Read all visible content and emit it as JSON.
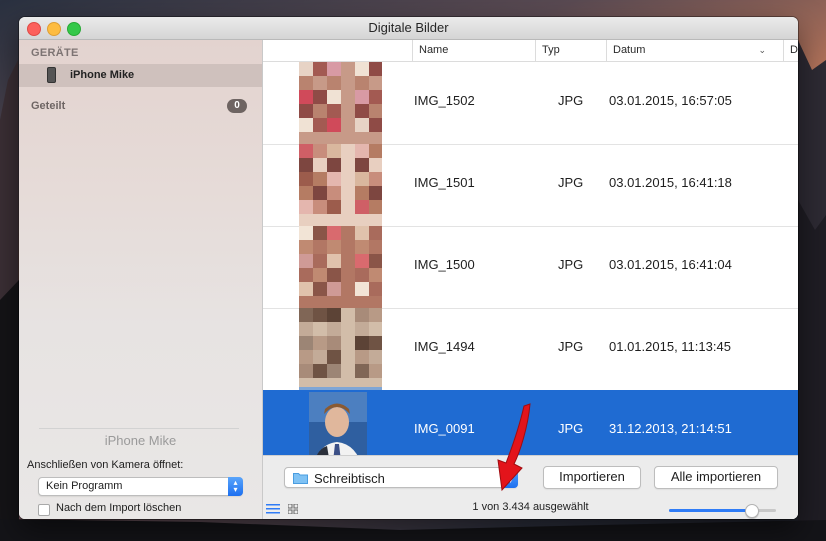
{
  "window": {
    "title": "Digitale Bilder"
  },
  "sidebar": {
    "section_devices": "GERÄTE",
    "device_item": "iPhone Mike",
    "shared_label": "Geteilt",
    "shared_count": "0",
    "device_name": "iPhone Mike",
    "connect_label": "Anschließen von Kamera öffnet:",
    "connect_value": "Kein Programm",
    "delete_after_import_label": "Nach dem Import löschen",
    "delete_after_import_checked": false
  },
  "columns": {
    "name": "Name",
    "type": "Typ",
    "date": "Datum",
    "extra": "Da"
  },
  "rows": [
    {
      "name": "IMG_1502",
      "type": "JPG",
      "date": "03.01.2015, 16:57:05",
      "selected": false
    },
    {
      "name": "IMG_1501",
      "type": "JPG",
      "date": "03.01.2015, 16:41:18",
      "selected": false
    },
    {
      "name": "IMG_1500",
      "type": "JPG",
      "date": "03.01.2015, 16:41:04",
      "selected": false
    },
    {
      "name": "IMG_1494",
      "type": "JPG",
      "date": "01.01.2015, 11:13:45",
      "selected": false
    },
    {
      "name": "IMG_0091",
      "type": "JPG",
      "date": "31.12.2013, 21:14:51",
      "selected": true
    }
  ],
  "bottom": {
    "destination": "Schreibtisch",
    "import_button": "Importieren",
    "import_all_button": "Alle importieren",
    "status": "1 von 3.434 ausgewählt",
    "thumbnail_size": 0.77
  },
  "colors": {
    "selection": "#1f6bd2",
    "accent": "#2f7cf6",
    "arrow": "#e3141b"
  }
}
